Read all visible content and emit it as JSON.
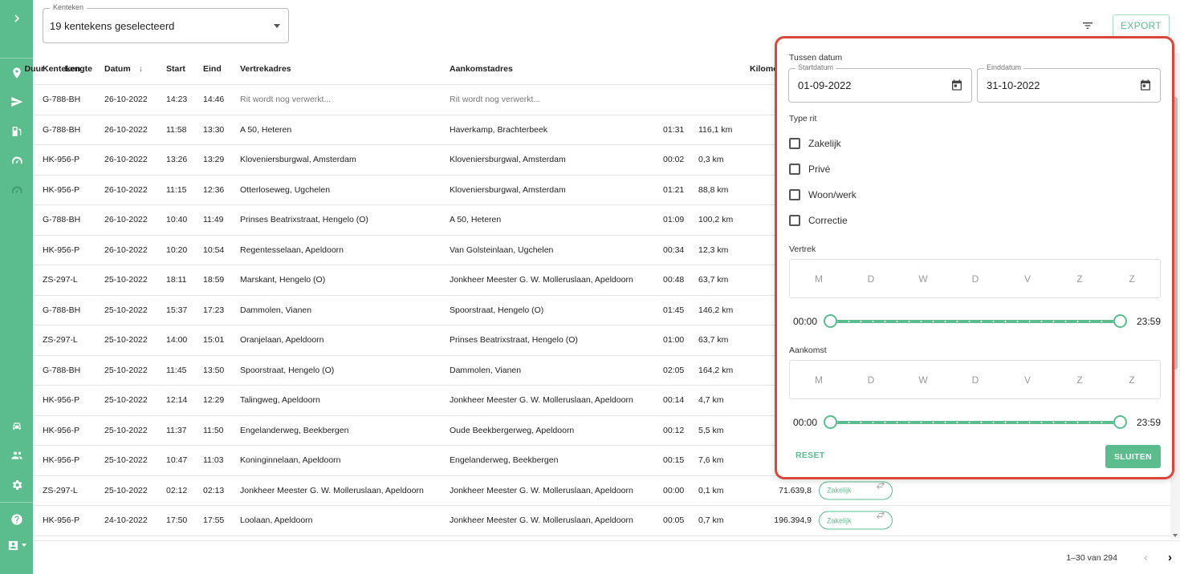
{
  "plate_select": {
    "label": "Kenteken",
    "value": "19 kentekens geselecteerd"
  },
  "toolbar": {
    "export_label": "EXPORT"
  },
  "table": {
    "headers": {
      "plate": "Kenteken",
      "date": "Datum",
      "start": "Start",
      "end": "Eind",
      "departure": "Vertrekadres",
      "arrival": "Aankomstadres",
      "duration": "Duur",
      "length": "Lengte",
      "odometer": "Kilomet"
    },
    "rows": [
      {
        "plate": "G-788-BH",
        "date": "26-10-2022",
        "start": "14:23",
        "end": "14:46",
        "departure": "Rit wordt nog verwerkt...",
        "arrival": "Rit wordt nog verwerkt...",
        "duration": "",
        "length": "",
        "odometer": "",
        "type": ""
      },
      {
        "plate": "G-788-BH",
        "date": "26-10-2022",
        "start": "11:58",
        "end": "13:30",
        "departure": "A 50, Heteren",
        "arrival": "Haverkamp, Brachterbeek",
        "duration": "01:31",
        "length": "116,1 km",
        "odometer": "",
        "type": ""
      },
      {
        "plate": "HK-956-P",
        "date": "26-10-2022",
        "start": "13:26",
        "end": "13:29",
        "departure": "Kloveniersburgwal, Amsterdam",
        "arrival": "Kloveniersburgwal, Amsterdam",
        "duration": "00:02",
        "length": "0,3 km",
        "odometer": "",
        "type": ""
      },
      {
        "plate": "HK-956-P",
        "date": "26-10-2022",
        "start": "11:15",
        "end": "12:36",
        "departure": "Otterloseweg, Ugchelen",
        "arrival": "Kloveniersburgwal, Amsterdam",
        "duration": "01:21",
        "length": "88,8 km",
        "odometer": "",
        "type": ""
      },
      {
        "plate": "G-788-BH",
        "date": "26-10-2022",
        "start": "10:40",
        "end": "11:49",
        "departure": "Prinses Beatrixstraat, Hengelo (O)",
        "arrival": "A 50, Heteren",
        "duration": "01:09",
        "length": "100,2 km",
        "odometer": "",
        "type": ""
      },
      {
        "plate": "HK-956-P",
        "date": "26-10-2022",
        "start": "10:20",
        "end": "10:54",
        "departure": "Regentesselaan, Apeldoorn",
        "arrival": "Van Golsteinlaan, Ugchelen",
        "duration": "00:34",
        "length": "12,3 km",
        "odometer": "",
        "type": ""
      },
      {
        "plate": "ZS-297-L",
        "date": "25-10-2022",
        "start": "18:11",
        "end": "18:59",
        "departure": "Marskant, Hengelo (O)",
        "arrival": "Jonkheer Meester G. W. Molleruslaan, Apeldoorn",
        "duration": "00:48",
        "length": "63,7 km",
        "odometer": "",
        "type": ""
      },
      {
        "plate": "G-788-BH",
        "date": "25-10-2022",
        "start": "15:37",
        "end": "17:23",
        "departure": "Dammolen, Vianen",
        "arrival": "Spoorstraat, Hengelo (O)",
        "duration": "01:45",
        "length": "146,2 km",
        "odometer": "",
        "type": ""
      },
      {
        "plate": "ZS-297-L",
        "date": "25-10-2022",
        "start": "14:00",
        "end": "15:01",
        "departure": "Oranjelaan, Apeldoorn",
        "arrival": "Prinses Beatrixstraat, Hengelo (O)",
        "duration": "01:00",
        "length": "63,7 km",
        "odometer": "",
        "type": ""
      },
      {
        "plate": "G-788-BH",
        "date": "25-10-2022",
        "start": "11:45",
        "end": "13:50",
        "departure": "Spoorstraat, Hengelo (O)",
        "arrival": "Dammolen, Vianen",
        "duration": "02:05",
        "length": "164,2 km",
        "odometer": "",
        "type": ""
      },
      {
        "plate": "HK-956-P",
        "date": "25-10-2022",
        "start": "12:14",
        "end": "12:29",
        "departure": "Talingweg, Apeldoorn",
        "arrival": "Jonkheer Meester G. W. Molleruslaan, Apeldoorn",
        "duration": "00:14",
        "length": "4,7 km",
        "odometer": "",
        "type": ""
      },
      {
        "plate": "HK-956-P",
        "date": "25-10-2022",
        "start": "11:37",
        "end": "11:50",
        "departure": "Engelanderweg, Beekbergen",
        "arrival": "Oude Beekbergerweg, Apeldoorn",
        "duration": "00:12",
        "length": "5,5 km",
        "odometer": "",
        "type": ""
      },
      {
        "plate": "HK-956-P",
        "date": "25-10-2022",
        "start": "10:47",
        "end": "11:03",
        "departure": "Koninginnelaan, Apeldoorn",
        "arrival": "Engelanderweg, Beekbergen",
        "duration": "00:15",
        "length": "7,6 km",
        "odometer": "",
        "type": ""
      },
      {
        "plate": "ZS-297-L",
        "date": "25-10-2022",
        "start": "02:12",
        "end": "02:13",
        "departure": "Jonkheer Meester G. W. Molleruslaan, Apeldoorn",
        "arrival": "Jonkheer Meester G. W. Molleruslaan, Apeldoorn",
        "duration": "00:00",
        "length": "0,1 km",
        "odometer": "71.639,8",
        "type": "Zakelijk"
      },
      {
        "plate": "HK-956-P",
        "date": "24-10-2022",
        "start": "17:50",
        "end": "17:55",
        "departure": "Loolaan, Apeldoorn",
        "arrival": "Jonkheer Meester G. W. Molleruslaan, Apeldoorn",
        "duration": "00:05",
        "length": "0,7 km",
        "odometer": "196.394,9",
        "type": "Zakelijk"
      }
    ]
  },
  "pagination": {
    "text": "1–30 van 294"
  },
  "filter_panel": {
    "date_title": "Tussen datum",
    "start_label": "Startdatum",
    "start_value": "01-09-2022",
    "end_label": "Einddatum",
    "end_value": "31-10-2022",
    "type_title": "Type rit",
    "types": [
      "Zakelijk",
      "Privé",
      "Woon/werk",
      "Correctie"
    ],
    "departure_title": "Vertrek",
    "arrival_title": "Aankomst",
    "days": [
      "M",
      "D",
      "W",
      "D",
      "V",
      "Z",
      "Z"
    ],
    "time_min": "00:00",
    "time_max": "23:59",
    "reset_label": "RESET",
    "close_label": "SLUITEN"
  }
}
